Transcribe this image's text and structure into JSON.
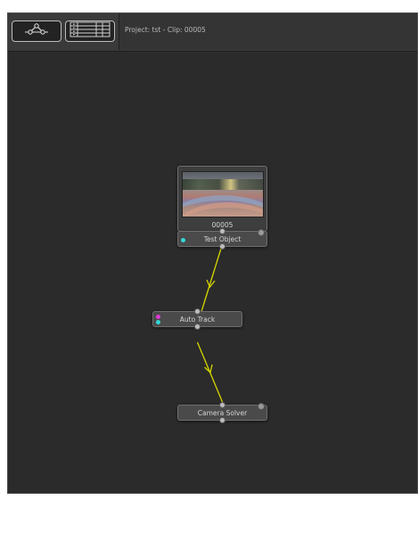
{
  "toolbar": {
    "graph_button_icon": "node-graph-icon",
    "list_button_icon": "list-view-icon",
    "project_info": "Project: tst - Clip: 00005"
  },
  "nodes": {
    "clip": {
      "label": "00005"
    },
    "test_object": {
      "label": "Test Object"
    },
    "auto_track": {
      "label": "Auto Track"
    },
    "camera_solver": {
      "label": "Camera Solver"
    }
  },
  "colors": {
    "wire": "#d6d600",
    "port_cyan": "#35d6d6",
    "port_magenta": "#e03ad6"
  }
}
